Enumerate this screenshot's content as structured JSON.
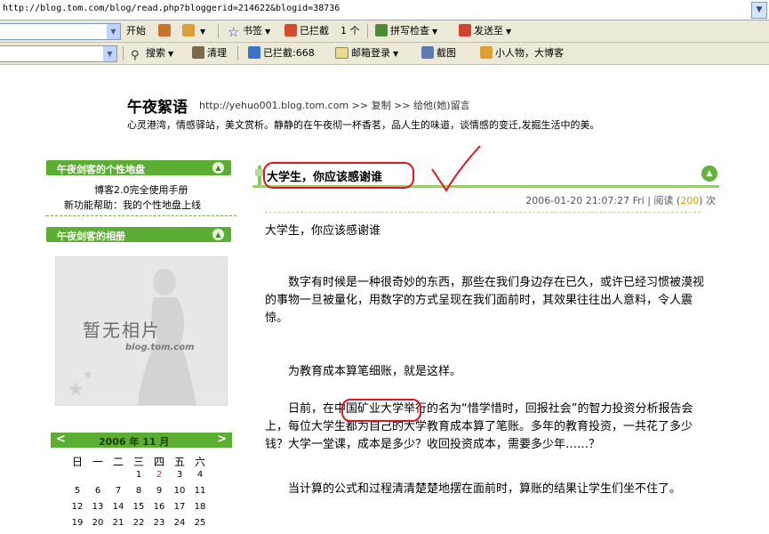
{
  "address": {
    "url": "http://blog.tom.com/blog/read.php?bloggerid=214622&blogid=38736"
  },
  "toolbar1": {
    "start": "开始",
    "bookmarks": "书签",
    "blocked": "已拦截",
    "blocked_count": "1 个",
    "spellcheck": "拼写检查",
    "sendto": "发送至"
  },
  "toolbar2": {
    "search": "搜索",
    "clear": "清理",
    "blocked": "已拦截:668",
    "mail_login": "邮箱登录",
    "screenshot": "截图",
    "person": "小人物，大博客"
  },
  "blog": {
    "title": "午夜絮语",
    "url": "http://yehuo001.blog.tom.com",
    "copy": ">> 复制",
    "message": ">> 给他(她)留言",
    "description": "心灵港湾，情感驿站，美文赏析。静静的在午夜彻一杯香茗，品人生的味道，谈情感的变迁,发掘生活中的美。"
  },
  "sidebar": {
    "panel1_title": "午夜剑客的个性地盘",
    "link1": "博客2.0完全使用手册",
    "link2": "新功能帮助：我的个性地盘上线",
    "panel2_title": "午夜剑客的相册",
    "photo_text": "暂无相片",
    "photo_sub": "blog.tom.com"
  },
  "calendar": {
    "title": "2006 年 11 月",
    "weekdays": [
      "日",
      "一",
      "二",
      "三",
      "四",
      "五",
      "六"
    ],
    "rows": [
      [
        "",
        "",
        "",
        "1",
        "2",
        "3",
        "4"
      ],
      [
        "5",
        "6",
        "7",
        "8",
        "9",
        "10",
        "11"
      ],
      [
        "12",
        "13",
        "14",
        "15",
        "16",
        "17",
        "18"
      ],
      [
        "19",
        "20",
        "21",
        "22",
        "23",
        "24",
        "25"
      ]
    ],
    "highlight_day": "2"
  },
  "post": {
    "title": "大学生，你应该感谢谁",
    "date": "2006-01-20 21:07:27 Fri",
    "read_label": "阅读",
    "read_count": "200",
    "read_suffix": "次",
    "heading": "大学生，你应该感谢谁",
    "p1": "数字有时候是一种很奇妙的东西，那些在我们身边存在已久，或许已经习惯被漠视的事物一旦被量化，用数字的方式呈现在我们面前时，其效果往往出人意料，令人震惊。",
    "p2": "为教育成本算笔细账，就是这样。",
    "p3": "日前，在中国矿业大学举行的名为“惜学惜时，回报社会”的智力投资分析报告会上，每位大学生都为自己的大学教育成本算了笔账。多年的教育投资，一共花了多少钱？大学一堂课，成本是多少？收回投资成本，需要多少年……？",
    "p4": "当计算的公式和过程清清楚楚地摆在面前时，算账的结果让学生们坐不住了。"
  },
  "colors": {
    "accent_green": "#5cae32",
    "annotation_red": "#e1131f",
    "read_count": "#e5a000"
  }
}
